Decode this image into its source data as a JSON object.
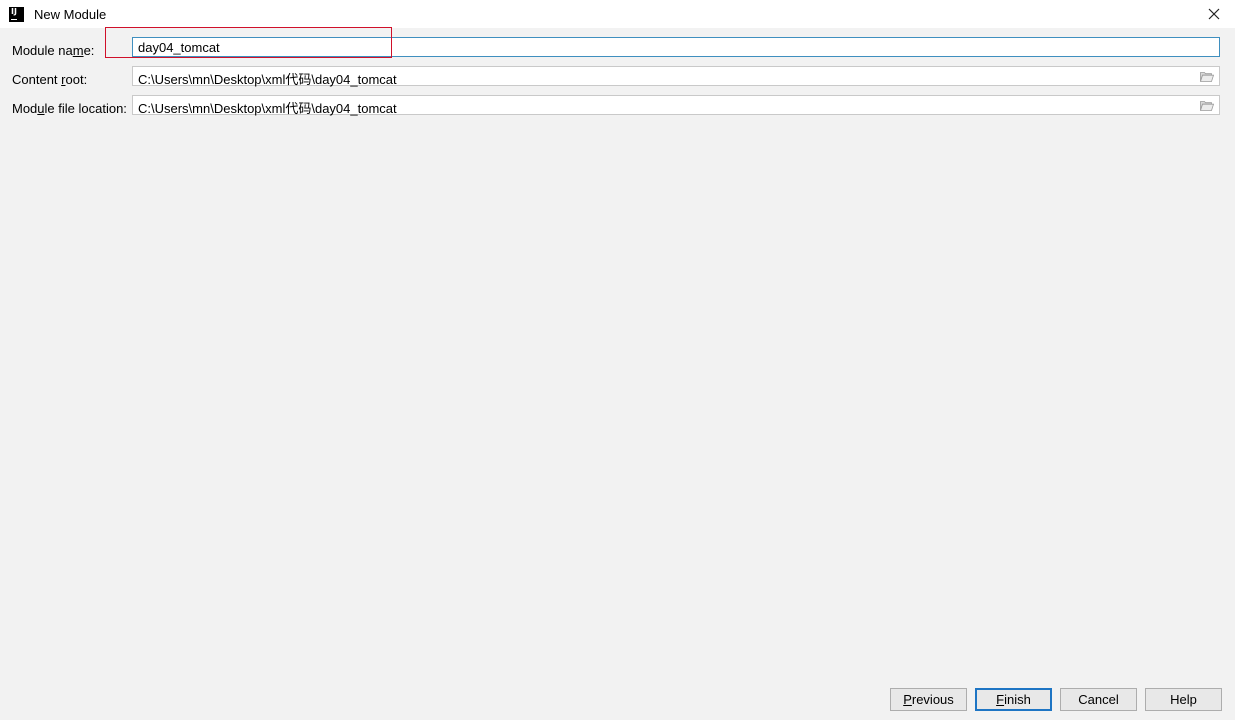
{
  "window": {
    "title": "New Module"
  },
  "form": {
    "module_name": {
      "label_pre": "Module na",
      "label_mnemonic": "m",
      "label_post": "e:",
      "value": "day04_tomcat"
    },
    "content_root": {
      "label_pre": "Content ",
      "label_mnemonic": "r",
      "label_post": "oot:",
      "value": "C:\\Users\\mn\\Desktop\\xml代码\\day04_tomcat"
    },
    "module_file_location": {
      "label_pre": "Mod",
      "label_mnemonic": "u",
      "label_post": "le file location:",
      "value": "C:\\Users\\mn\\Desktop\\xml代码\\day04_tomcat"
    }
  },
  "buttons": {
    "previous": {
      "mnemonic": "P",
      "rest": "revious"
    },
    "finish": {
      "mnemonic": "F",
      "rest": "inish"
    },
    "cancel": "Cancel",
    "help": "Help"
  },
  "colors": {
    "background": "#f2f2f2",
    "focus_border": "#3f8fbf",
    "annotation_box": "#d0102a",
    "default_button_border": "#1e75c4"
  },
  "icons": {
    "app": "intellij-icon",
    "close": "close-icon",
    "browse": "folder-icon"
  }
}
